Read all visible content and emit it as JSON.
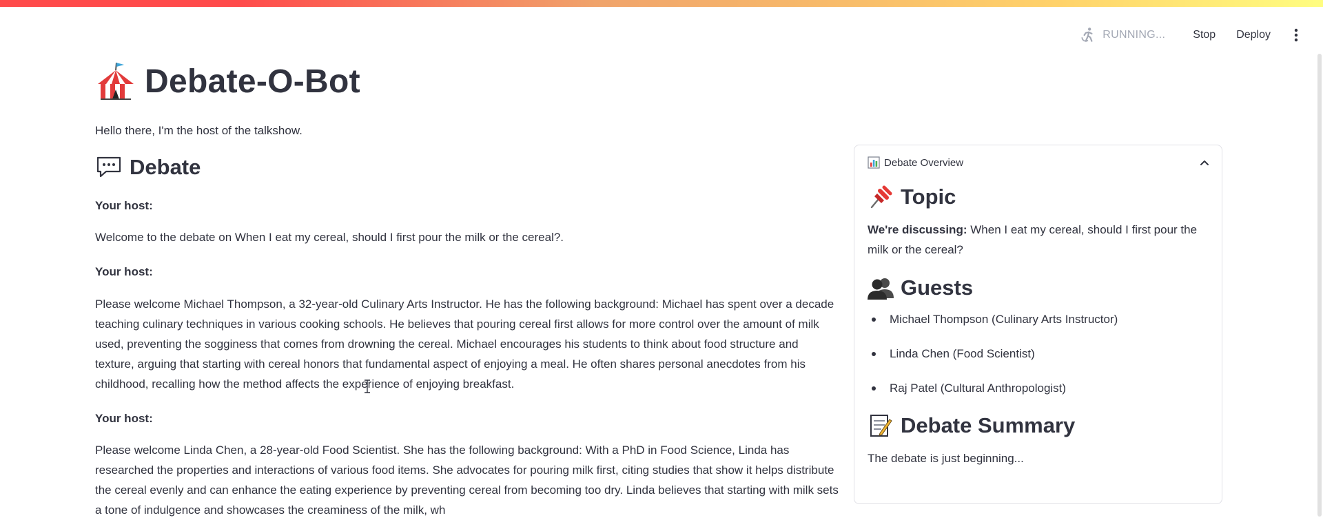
{
  "toolbar": {
    "status_text": "RUNNING...",
    "stop_label": "Stop",
    "deploy_label": "Deploy"
  },
  "header": {
    "title": "Debate-O-Bot",
    "intro": "Hello there, I'm the host of the talkshow."
  },
  "debate": {
    "heading": "Debate",
    "messages": [
      {
        "speaker": "Your host:",
        "text": "Welcome to the debate on When I eat my cereal, should I first pour the milk or the cereal?."
      },
      {
        "speaker": "Your host:",
        "text": "Please welcome Michael Thompson, a 32-year-old Culinary Arts Instructor. He has the following background: Michael has spent over a decade teaching culinary techniques in various cooking schools. He believes that pouring cereal first allows for more control over the amount of milk used, preventing the sogginess that comes from drowning the cereal. Michael encourages his students to think about food structure and texture, arguing that starting with cereal honors that fundamental aspect of enjoying a meal. He often shares personal anecdotes from his childhood, recalling how the method affects the experience of enjoying breakfast."
      },
      {
        "speaker": "Your host:",
        "text": "Please welcome Linda Chen, a 28-year-old Food Scientist. She has the following background: With a PhD in Food Science, Linda has researched the properties and interactions of various food items. She advocates for pouring milk first, citing studies that show it helps distribute the cereal evenly and can enhance the eating experience by preventing cereal from becoming too dry. Linda believes that starting with milk sets a tone of indulgence and showcases the creaminess of the milk, wh"
      }
    ]
  },
  "overview": {
    "header": "Debate Overview",
    "topic_heading": "Topic",
    "topic_label": "We're discussing:",
    "topic_text": "When I eat my cereal, should I first pour the milk or the cereal?",
    "guests_heading": "Guests",
    "guests": [
      "Michael Thompson (Culinary Arts Instructor)",
      "Linda Chen (Food Scientist)",
      "Raj Patel (Cultural Anthropologist)"
    ],
    "summary_heading": "Debate Summary",
    "summary_text": "The debate is just beginning..."
  },
  "icons": {
    "title": "circus-tent-icon",
    "debate": "speech-balloon-icon",
    "overview": "bar-chart-icon",
    "topic": "pushpin-icon",
    "guests": "busts-in-silhouette-icon",
    "summary": "memo-icon",
    "status": "running-figure-icon",
    "menu": "kebab-menu-icon",
    "collapse": "chevron-up-icon"
  }
}
